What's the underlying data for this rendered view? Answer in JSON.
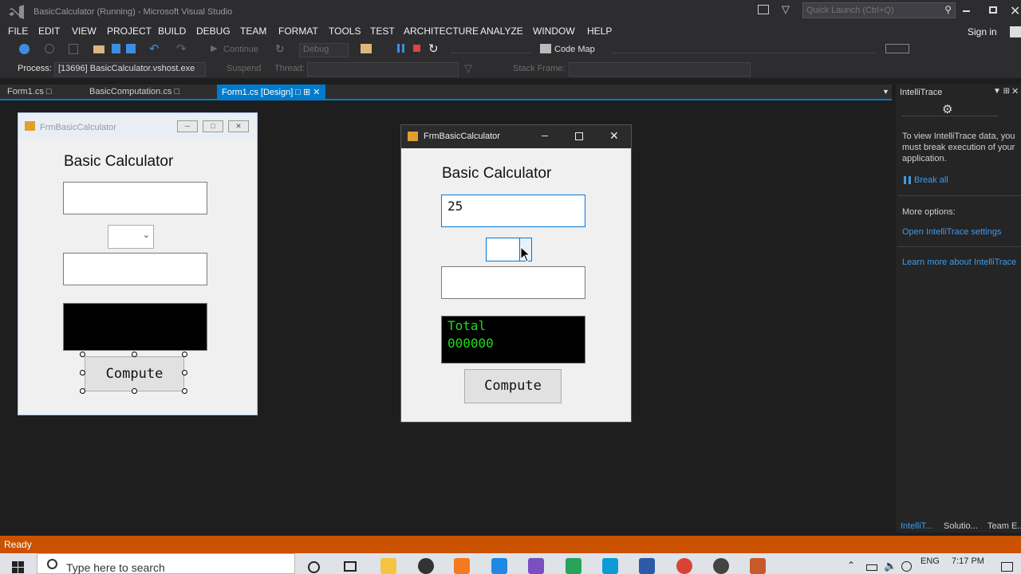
{
  "window": {
    "title": "BasicCalculator (Running) - Microsoft Visual Studio",
    "quick_launch_placeholder": "Quick Launch (Ctrl+Q)",
    "signin": "Sign in"
  },
  "menu": [
    "FILE",
    "EDIT",
    "VIEW",
    "PROJECT",
    "BUILD",
    "DEBUG",
    "TEAM",
    "FORMAT",
    "TOOLS",
    "TEST",
    "ARCHITECTURE",
    "ANALYZE",
    "WINDOW",
    "HELP"
  ],
  "toolbar": {
    "continue": "Continue",
    "config": "Debug",
    "code_map": "Code Map"
  },
  "toolbar2": {
    "process_label": "Process:",
    "process_value": "[13696] BasicCalculator.vshost.exe",
    "suspend": "Suspend",
    "thread": "Thread:",
    "stack_frame": "Stack Frame:"
  },
  "tabs": [
    "Form1.cs",
    "BasicComputation.cs",
    "Form1.cs [Design]"
  ],
  "design_form": {
    "title": "FrmBasicCalculator",
    "heading": "Basic Calculator",
    "button": "Compute"
  },
  "running_form": {
    "title": "FrmBasicCalculator",
    "heading": "Basic Calculator",
    "input1": "25",
    "input2": "",
    "display_line1": "Total",
    "display_line2": "000000",
    "button": "Compute"
  },
  "intellitrace": {
    "header": "IntelliTrace",
    "message": "To view IntelliTrace data, you must break execution of your application.",
    "break_all": "Break all",
    "more_options": "More options:",
    "open_settings": "Open IntelliTrace settings",
    "learn_more": "Learn more about IntelliTrace",
    "bottom_tabs": [
      "IntelliT...",
      "Solutio...",
      "Team E..."
    ]
  },
  "status": "Ready",
  "taskbar": {
    "search_placeholder": "Type here to search",
    "lang": "ENG",
    "time": "7:17 PM"
  }
}
